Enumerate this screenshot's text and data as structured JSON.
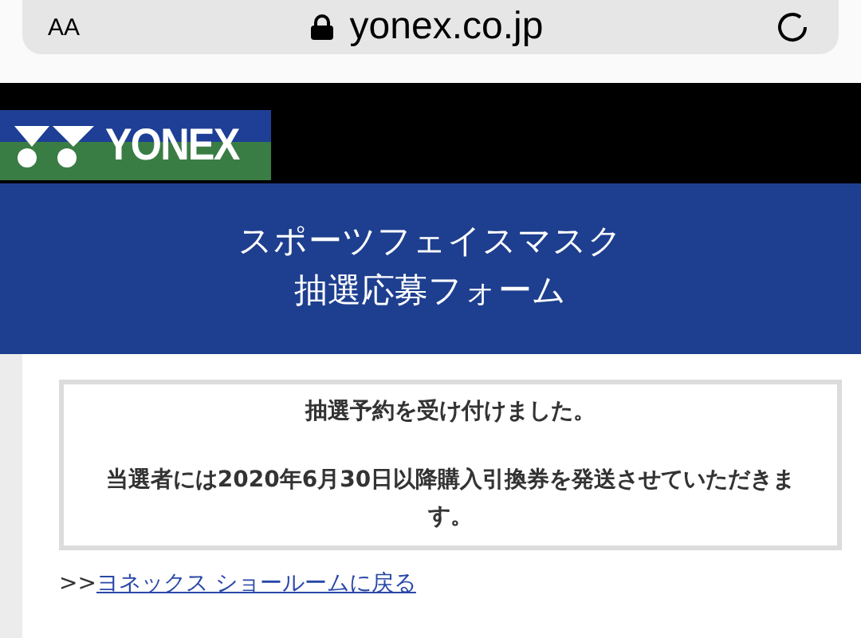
{
  "browser": {
    "text_size_button": "AA",
    "url": "yonex.co.jp"
  },
  "logo": {
    "text": "YONEX"
  },
  "header": {
    "title_lines": [
      "スポーツフェイスマスク",
      "抽選応募フォーム"
    ]
  },
  "message": {
    "heading": "抽選予約を受け付けました。",
    "body": "当選者には2020年6月30日以降購入引換券を発送させていただきます。"
  },
  "back_link": {
    "prefix": ">>",
    "label": "ヨネックス ショールームに戻る"
  }
}
